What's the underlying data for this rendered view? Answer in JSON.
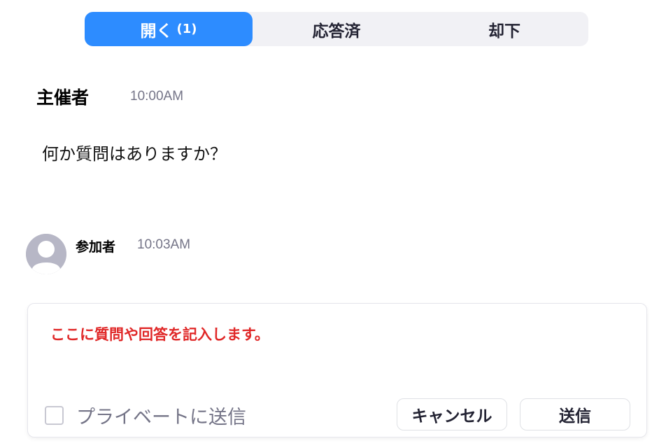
{
  "tabs": [
    {
      "label": "開く",
      "count": "(1)",
      "active": true
    },
    {
      "label": "応答済",
      "count": "",
      "active": false
    },
    {
      "label": "却下",
      "count": "",
      "active": false
    }
  ],
  "host": {
    "name": "主催者",
    "time": "10:00AM",
    "question": "何か質問はありますか？"
  },
  "participant": {
    "name": "参加者",
    "time": "10:03AM",
    "avatar_icon": "user-avatar-icon"
  },
  "composer": {
    "text": "ここに質問や回答を記入します。",
    "private_label": "プライベートに送信",
    "private_checked": false,
    "cancel_label": "キャンセル",
    "send_label": "送信"
  },
  "colors": {
    "accent": "#2d8cff",
    "composer_text": "#e02828",
    "muted": "#747487"
  }
}
